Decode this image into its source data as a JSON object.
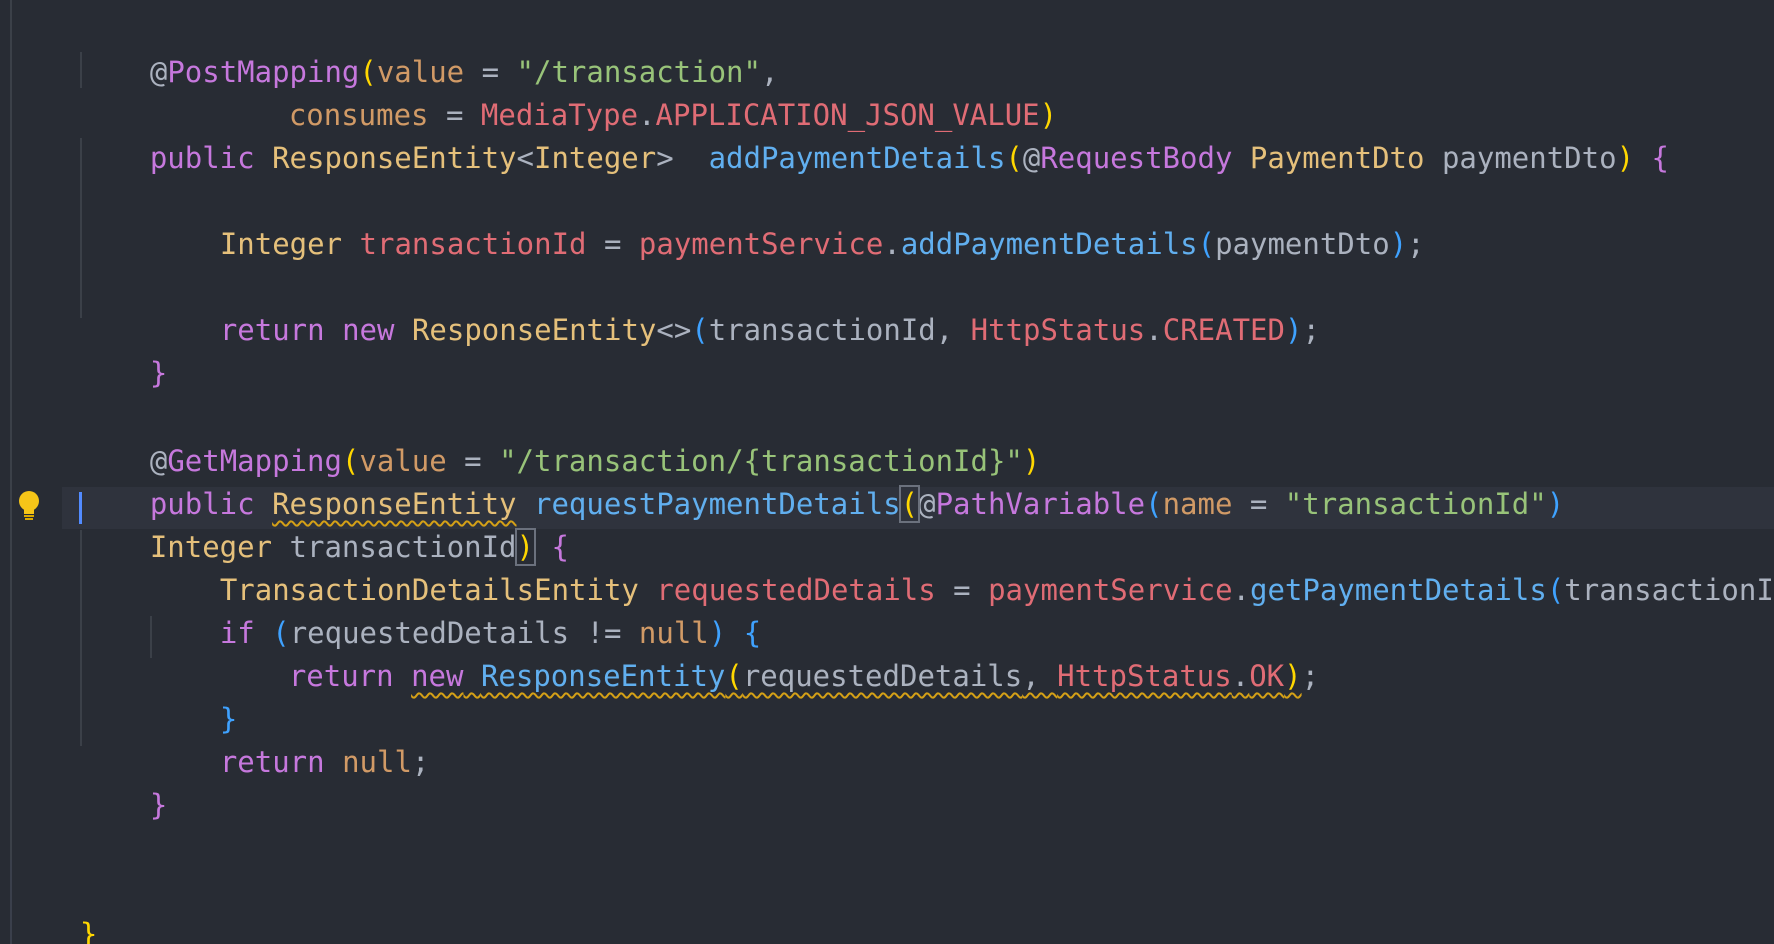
{
  "code": {
    "l1": [
      "@",
      "PostMapping",
      "(",
      "value",
      " = ",
      "\"/transaction\"",
      ","
    ],
    "l2": [
      "consumes",
      " = ",
      "MediaType",
      ".",
      "APPLICATION_JSON_VALUE",
      ")"
    ],
    "l3": [
      "public",
      " ",
      "ResponseEntity",
      "<",
      "Integer",
      ">  ",
      "addPaymentDetails",
      "(",
      "@",
      "RequestBody",
      " ",
      "PaymentDto",
      " ",
      "paymentDto",
      ")",
      " ",
      "{"
    ],
    "l5": [
      "Integer",
      " ",
      "transactionId",
      " = ",
      "paymentService",
      ".",
      "addPaymentDetails",
      "(",
      "paymentDto",
      ")",
      ";"
    ],
    "l7": [
      "return",
      " ",
      "new",
      " ",
      "ResponseEntity",
      "<>",
      "(",
      "transactionId",
      ", ",
      "HttpStatus",
      ".",
      "CREATED",
      ")",
      ";"
    ],
    "l8": [
      "}"
    ],
    "l10": [
      "@",
      "GetMapping",
      "(",
      "value",
      " = ",
      "\"/transaction/{transactionId}\"",
      ")"
    ],
    "l11": [
      "public",
      " ",
      "ResponseEntity",
      " ",
      "requestPaymentDetails",
      "(",
      "@",
      "PathVariable",
      "(",
      "name",
      " = ",
      "\"transactionId\"",
      ")"
    ],
    "l12": [
      "Integer",
      " ",
      "transactionId",
      ")",
      " ",
      "{"
    ],
    "l13": [
      "TransactionDetailsEntity",
      " ",
      "requestedDetails",
      " = ",
      "paymentService",
      ".",
      "getPaymentDetails",
      "(",
      "transactionId",
      ")",
      ";"
    ],
    "l14": [
      "if",
      " ",
      "(",
      "requestedDetails",
      " != ",
      "null",
      ")",
      " ",
      "{"
    ],
    "l15": [
      "return",
      " ",
      "new",
      " ",
      "ResponseEntity",
      "(",
      "requestedDetails",
      ", ",
      "HttpStatus",
      ".",
      "OK",
      ")",
      ";"
    ],
    "l16": [
      "}"
    ],
    "l17": [
      "return",
      " ",
      "null",
      ";"
    ],
    "l18": [
      "}"
    ],
    "l21": [
      "}"
    ]
  },
  "icons": {
    "gutter_hint": "lightbulb-icon"
  },
  "colors": {
    "background": "#282c34",
    "keyword": "#c678dd",
    "type": "#e5c07b",
    "function": "#61afef",
    "string": "#98c379",
    "variable": "#e06c75",
    "warning": "#d4a017",
    "bulb": "#f5c518"
  }
}
